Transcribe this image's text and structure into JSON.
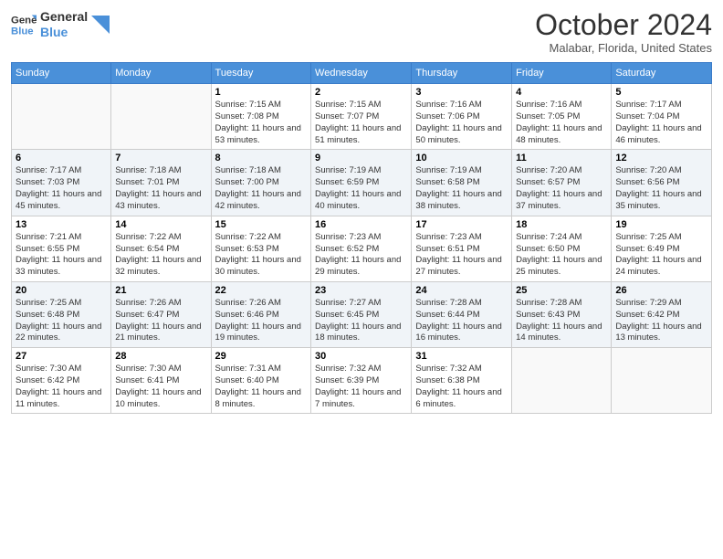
{
  "logo": {
    "line1": "General",
    "line2": "Blue"
  },
  "title": "October 2024",
  "location": "Malabar, Florida, United States",
  "days_of_week": [
    "Sunday",
    "Monday",
    "Tuesday",
    "Wednesday",
    "Thursday",
    "Friday",
    "Saturday"
  ],
  "weeks": [
    [
      {
        "day": "",
        "sunrise": "",
        "sunset": "",
        "daylight": ""
      },
      {
        "day": "",
        "sunrise": "",
        "sunset": "",
        "daylight": ""
      },
      {
        "day": "1",
        "sunrise": "Sunrise: 7:15 AM",
        "sunset": "Sunset: 7:08 PM",
        "daylight": "Daylight: 11 hours and 53 minutes."
      },
      {
        "day": "2",
        "sunrise": "Sunrise: 7:15 AM",
        "sunset": "Sunset: 7:07 PM",
        "daylight": "Daylight: 11 hours and 51 minutes."
      },
      {
        "day": "3",
        "sunrise": "Sunrise: 7:16 AM",
        "sunset": "Sunset: 7:06 PM",
        "daylight": "Daylight: 11 hours and 50 minutes."
      },
      {
        "day": "4",
        "sunrise": "Sunrise: 7:16 AM",
        "sunset": "Sunset: 7:05 PM",
        "daylight": "Daylight: 11 hours and 48 minutes."
      },
      {
        "day": "5",
        "sunrise": "Sunrise: 7:17 AM",
        "sunset": "Sunset: 7:04 PM",
        "daylight": "Daylight: 11 hours and 46 minutes."
      }
    ],
    [
      {
        "day": "6",
        "sunrise": "Sunrise: 7:17 AM",
        "sunset": "Sunset: 7:03 PM",
        "daylight": "Daylight: 11 hours and 45 minutes."
      },
      {
        "day": "7",
        "sunrise": "Sunrise: 7:18 AM",
        "sunset": "Sunset: 7:01 PM",
        "daylight": "Daylight: 11 hours and 43 minutes."
      },
      {
        "day": "8",
        "sunrise": "Sunrise: 7:18 AM",
        "sunset": "Sunset: 7:00 PM",
        "daylight": "Daylight: 11 hours and 42 minutes."
      },
      {
        "day": "9",
        "sunrise": "Sunrise: 7:19 AM",
        "sunset": "Sunset: 6:59 PM",
        "daylight": "Daylight: 11 hours and 40 minutes."
      },
      {
        "day": "10",
        "sunrise": "Sunrise: 7:19 AM",
        "sunset": "Sunset: 6:58 PM",
        "daylight": "Daylight: 11 hours and 38 minutes."
      },
      {
        "day": "11",
        "sunrise": "Sunrise: 7:20 AM",
        "sunset": "Sunset: 6:57 PM",
        "daylight": "Daylight: 11 hours and 37 minutes."
      },
      {
        "day": "12",
        "sunrise": "Sunrise: 7:20 AM",
        "sunset": "Sunset: 6:56 PM",
        "daylight": "Daylight: 11 hours and 35 minutes."
      }
    ],
    [
      {
        "day": "13",
        "sunrise": "Sunrise: 7:21 AM",
        "sunset": "Sunset: 6:55 PM",
        "daylight": "Daylight: 11 hours and 33 minutes."
      },
      {
        "day": "14",
        "sunrise": "Sunrise: 7:22 AM",
        "sunset": "Sunset: 6:54 PM",
        "daylight": "Daylight: 11 hours and 32 minutes."
      },
      {
        "day": "15",
        "sunrise": "Sunrise: 7:22 AM",
        "sunset": "Sunset: 6:53 PM",
        "daylight": "Daylight: 11 hours and 30 minutes."
      },
      {
        "day": "16",
        "sunrise": "Sunrise: 7:23 AM",
        "sunset": "Sunset: 6:52 PM",
        "daylight": "Daylight: 11 hours and 29 minutes."
      },
      {
        "day": "17",
        "sunrise": "Sunrise: 7:23 AM",
        "sunset": "Sunset: 6:51 PM",
        "daylight": "Daylight: 11 hours and 27 minutes."
      },
      {
        "day": "18",
        "sunrise": "Sunrise: 7:24 AM",
        "sunset": "Sunset: 6:50 PM",
        "daylight": "Daylight: 11 hours and 25 minutes."
      },
      {
        "day": "19",
        "sunrise": "Sunrise: 7:25 AM",
        "sunset": "Sunset: 6:49 PM",
        "daylight": "Daylight: 11 hours and 24 minutes."
      }
    ],
    [
      {
        "day": "20",
        "sunrise": "Sunrise: 7:25 AM",
        "sunset": "Sunset: 6:48 PM",
        "daylight": "Daylight: 11 hours and 22 minutes."
      },
      {
        "day": "21",
        "sunrise": "Sunrise: 7:26 AM",
        "sunset": "Sunset: 6:47 PM",
        "daylight": "Daylight: 11 hours and 21 minutes."
      },
      {
        "day": "22",
        "sunrise": "Sunrise: 7:26 AM",
        "sunset": "Sunset: 6:46 PM",
        "daylight": "Daylight: 11 hours and 19 minutes."
      },
      {
        "day": "23",
        "sunrise": "Sunrise: 7:27 AM",
        "sunset": "Sunset: 6:45 PM",
        "daylight": "Daylight: 11 hours and 18 minutes."
      },
      {
        "day": "24",
        "sunrise": "Sunrise: 7:28 AM",
        "sunset": "Sunset: 6:44 PM",
        "daylight": "Daylight: 11 hours and 16 minutes."
      },
      {
        "day": "25",
        "sunrise": "Sunrise: 7:28 AM",
        "sunset": "Sunset: 6:43 PM",
        "daylight": "Daylight: 11 hours and 14 minutes."
      },
      {
        "day": "26",
        "sunrise": "Sunrise: 7:29 AM",
        "sunset": "Sunset: 6:42 PM",
        "daylight": "Daylight: 11 hours and 13 minutes."
      }
    ],
    [
      {
        "day": "27",
        "sunrise": "Sunrise: 7:30 AM",
        "sunset": "Sunset: 6:42 PM",
        "daylight": "Daylight: 11 hours and 11 minutes."
      },
      {
        "day": "28",
        "sunrise": "Sunrise: 7:30 AM",
        "sunset": "Sunset: 6:41 PM",
        "daylight": "Daylight: 11 hours and 10 minutes."
      },
      {
        "day": "29",
        "sunrise": "Sunrise: 7:31 AM",
        "sunset": "Sunset: 6:40 PM",
        "daylight": "Daylight: 11 hours and 8 minutes."
      },
      {
        "day": "30",
        "sunrise": "Sunrise: 7:32 AM",
        "sunset": "Sunset: 6:39 PM",
        "daylight": "Daylight: 11 hours and 7 minutes."
      },
      {
        "day": "31",
        "sunrise": "Sunrise: 7:32 AM",
        "sunset": "Sunset: 6:38 PM",
        "daylight": "Daylight: 11 hours and 6 minutes."
      },
      {
        "day": "",
        "sunrise": "",
        "sunset": "",
        "daylight": ""
      },
      {
        "day": "",
        "sunrise": "",
        "sunset": "",
        "daylight": ""
      }
    ]
  ]
}
